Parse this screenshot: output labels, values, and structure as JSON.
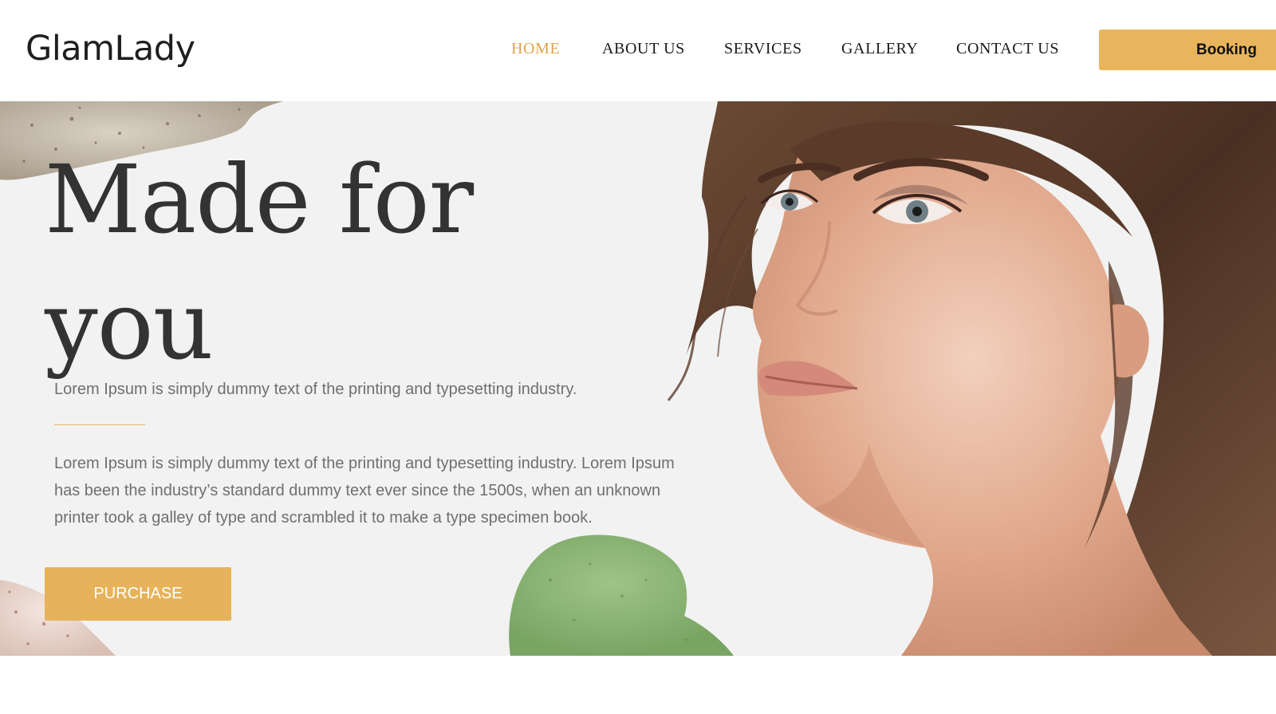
{
  "brand": {
    "logo_text": "GlamLady",
    "accent_color": "#e7b35a"
  },
  "nav": {
    "items": [
      {
        "label": "HOME",
        "active": true
      },
      {
        "label": "ABOUT US",
        "active": false
      },
      {
        "label": "SERVICES",
        "active": false
      },
      {
        "label": "GALLERY",
        "active": false
      },
      {
        "label": "CONTACT US",
        "active": false
      }
    ],
    "booking_label": "Booking"
  },
  "hero": {
    "headline_line1": "Made for",
    "headline_line2": "you",
    "tagline": "Lorem Ipsum is simply dummy text of the printing and typesetting industry.",
    "body": "Lorem Ipsum is simply dummy text of the printing and typesetting industry. Lorem Ipsum has been the industry’s standard dummy text ever since the 1500s, when an unknown printer took a galley of type and scrambled it to make a type specimen book.",
    "cta_label": "PURCHASE",
    "image_subject": "woman-portrait"
  }
}
